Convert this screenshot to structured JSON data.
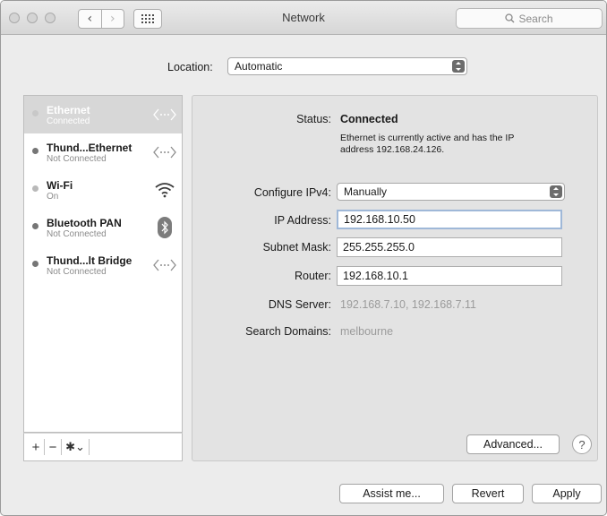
{
  "window": {
    "title": "Network"
  },
  "toolbar": {
    "search_placeholder": "Search"
  },
  "location": {
    "label": "Location:",
    "value": "Automatic"
  },
  "services": [
    {
      "name": "Ethernet",
      "status": "Connected",
      "icon": "ethernet-icon",
      "selected": true
    },
    {
      "name": "Thund...Ethernet",
      "status": "Not Connected",
      "icon": "ethernet-icon"
    },
    {
      "name": "Wi-Fi",
      "status": "On",
      "icon": "wifi-icon"
    },
    {
      "name": "Bluetooth PAN",
      "status": "Not Connected",
      "icon": "bluetooth-icon"
    },
    {
      "name": "Thund...lt Bridge",
      "status": "Not Connected",
      "icon": "ethernet-icon"
    }
  ],
  "sidebar_footer": {
    "add": "+",
    "remove": "−",
    "gear": "✱⌄"
  },
  "detail": {
    "status_label": "Status:",
    "status_value": "Connected",
    "status_desc_1": "Ethernet is currently active and has the IP",
    "status_desc_2": "address 192.168.24.126.",
    "configure_label": "Configure IPv4:",
    "configure_value": "Manually",
    "ip_label": "IP Address:",
    "ip_value": "192.168.10.50",
    "subnet_label": "Subnet Mask:",
    "subnet_value": "255.255.255.0",
    "router_label": "Router:",
    "router_value": "192.168.10.1",
    "dns_label": "DNS Server:",
    "dns_value": "192.168.7.10, 192.168.7.11",
    "domains_label": "Search Domains:",
    "domains_value": "melbourne",
    "advanced_label": "Advanced...",
    "help_label": "?"
  },
  "footer": {
    "assist_label": "Assist me...",
    "revert_label": "Revert",
    "apply_label": "Apply"
  }
}
